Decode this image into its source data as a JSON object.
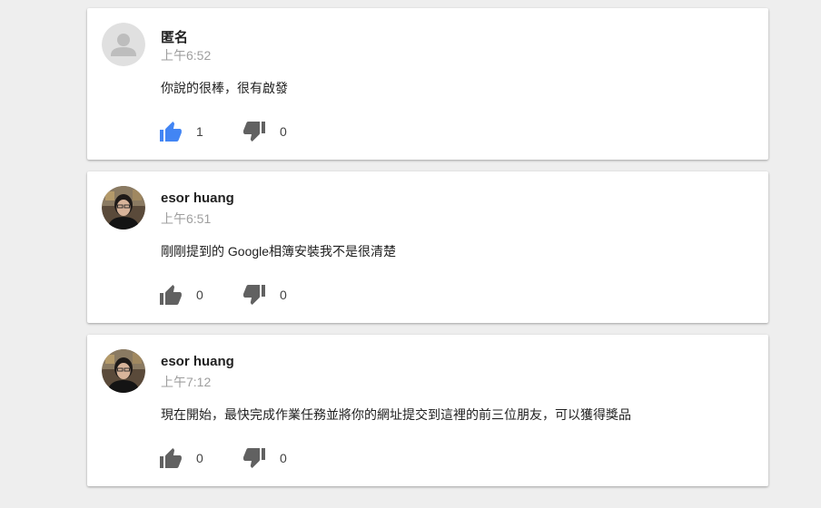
{
  "colors": {
    "like_active": "#4285f4",
    "icon_default": "#616161",
    "card_bg": "#ffffff",
    "page_bg": "#eeeeee"
  },
  "comments": [
    {
      "author": "匿名",
      "time": "上午6:52",
      "text": "你說的很棒，很有啟發",
      "likes": "1",
      "dislikes": "0",
      "avatar": "default-avatar-icon",
      "liked": true
    },
    {
      "author": "esor huang",
      "time": "上午6:51",
      "text": "剛剛提到的 Google相簿安裝我不是很清楚",
      "likes": "0",
      "dislikes": "0",
      "avatar": "user-photo",
      "liked": false
    },
    {
      "author": "esor huang",
      "time": "上午7:12",
      "text": "現在開始，最快完成作業任務並將你的網址提交到這裡的前三位朋友，可以獲得獎品",
      "likes": "0",
      "dislikes": "0",
      "avatar": "user-photo",
      "liked": false
    }
  ]
}
